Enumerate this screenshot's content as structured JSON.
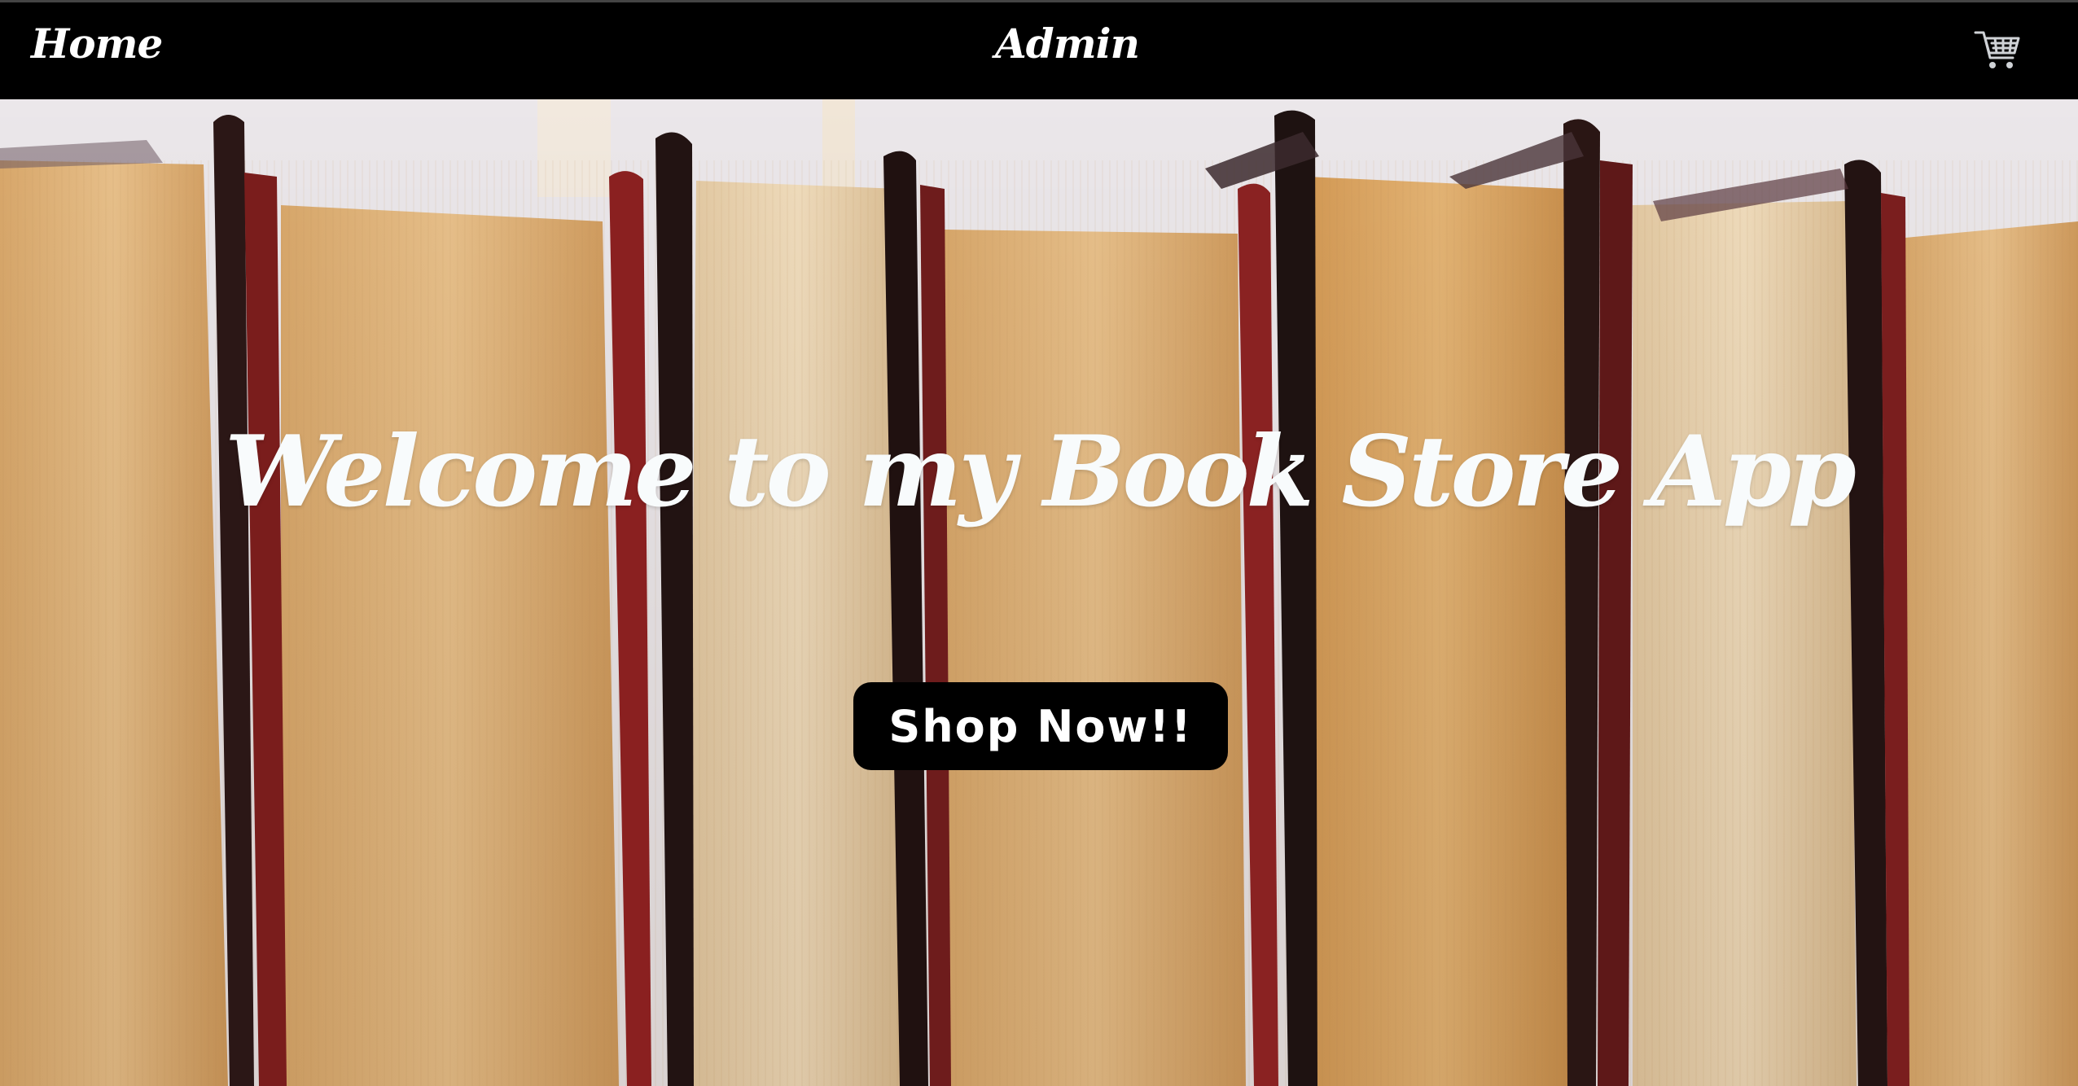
{
  "nav": {
    "home_label": "Home",
    "admin_label": "Admin",
    "cart_icon": "shopping-cart-icon"
  },
  "hero": {
    "headline": "Welcome to my Book Store App",
    "cta_label": "Shop Now!!",
    "background_image": "row of old books"
  },
  "colors": {
    "navbar": "#000000",
    "nav_text": "#ffffff",
    "headline": "#f8fbfc",
    "button": "#000000",
    "button_text": "#ffffff"
  }
}
